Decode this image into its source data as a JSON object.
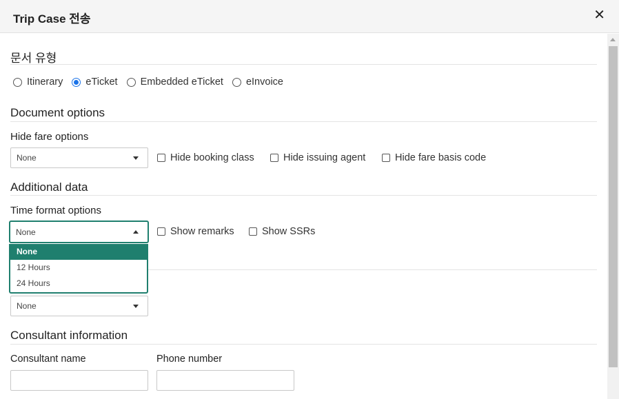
{
  "dialog": {
    "title": "Trip Case 전송",
    "close_label": "✕"
  },
  "document_type": {
    "title": "문서 유형",
    "options": [
      {
        "label": "Itinerary",
        "checked": false
      },
      {
        "label": "eTicket",
        "checked": true
      },
      {
        "label": "Embedded eTicket",
        "checked": false
      },
      {
        "label": "eInvoice",
        "checked": false
      }
    ]
  },
  "document_options": {
    "title": "Document options",
    "hide_fare_label": "Hide fare options",
    "hide_fare_value": "None",
    "checkboxes": [
      "Hide booking class",
      "Hide issuing agent",
      "Hide fare basis code"
    ]
  },
  "additional_data": {
    "title": "Additional data",
    "time_format_label": "Time format options",
    "time_format_value": "None",
    "checkboxes": [
      "Show remarks",
      "Show SSRs"
    ],
    "dropdown_options": [
      "None",
      "12 Hours",
      "24 Hours"
    ],
    "selected_option": "None"
  },
  "hidden_section": {
    "select_value": "None"
  },
  "consultant": {
    "title": "Consultant information",
    "name_label": "Consultant name",
    "phone_label": "Phone number",
    "name_value": "",
    "phone_value": ""
  }
}
